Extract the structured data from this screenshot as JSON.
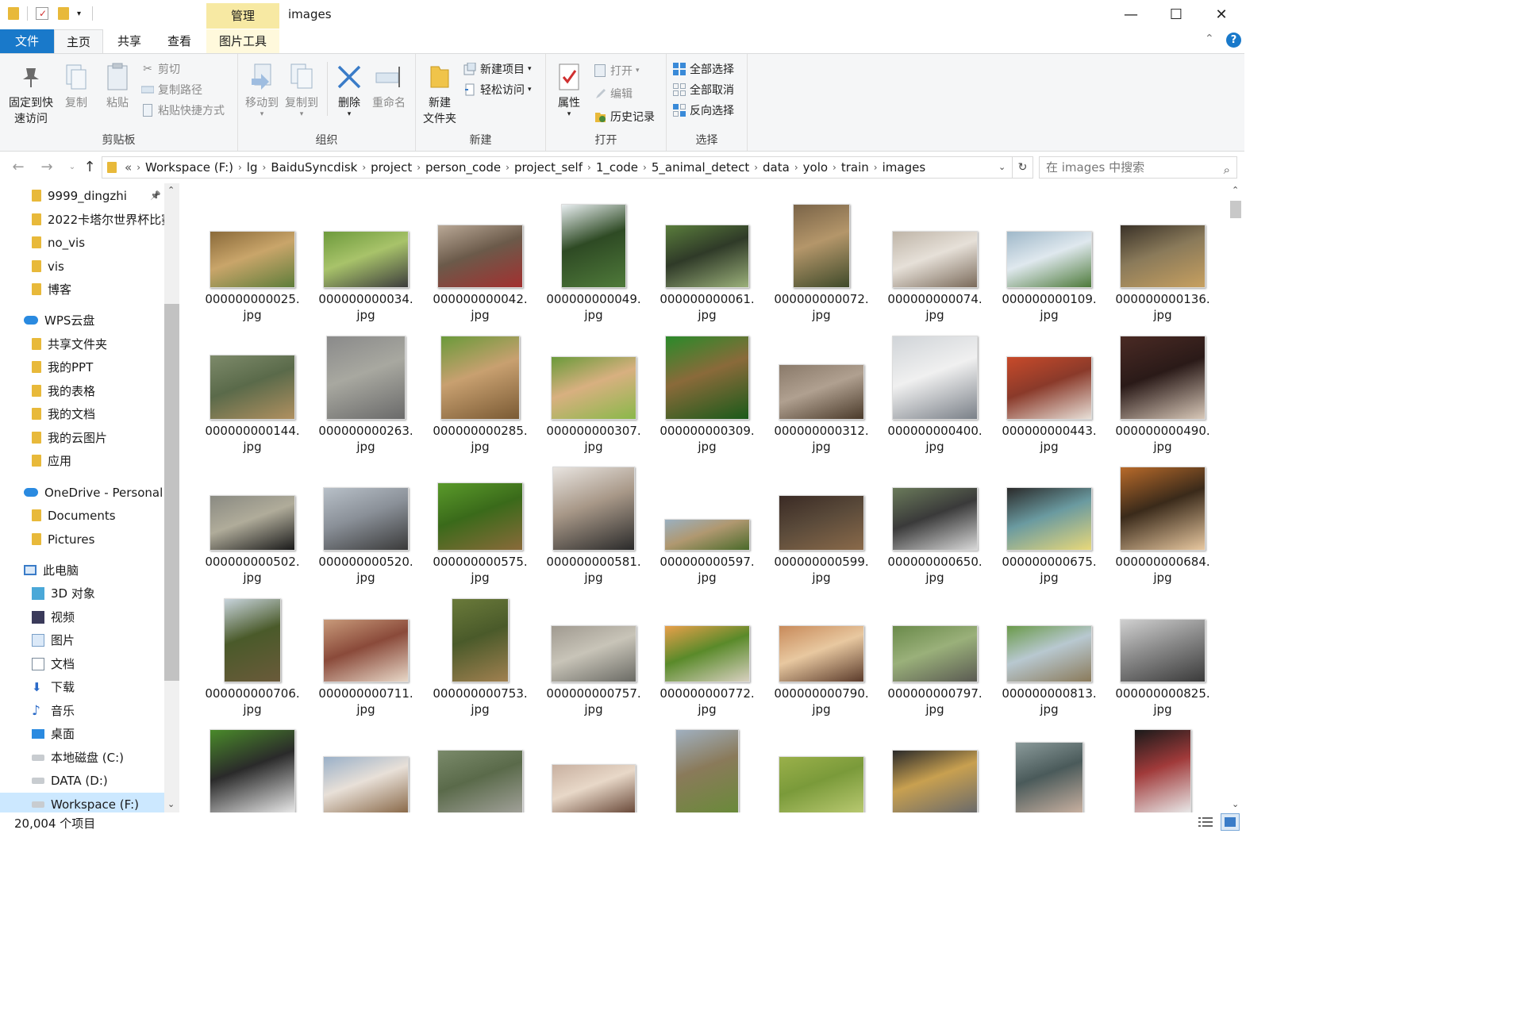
{
  "window": {
    "title": "images",
    "context_tab_header": "管理",
    "minimize": "—",
    "maximize": "☐",
    "close": "✕"
  },
  "tabs": [
    {
      "label": "文件"
    },
    {
      "label": "主页"
    },
    {
      "label": "共享"
    },
    {
      "label": "查看"
    },
    {
      "label": "图片工具"
    }
  ],
  "ribbon": {
    "clipboard": {
      "label": "剪贴板",
      "pin": "固定到快\n速访问",
      "copy": "复制",
      "paste": "粘贴",
      "cut": "剪切",
      "copy_path": "复制路径",
      "paste_shortcut": "粘贴快捷方式"
    },
    "organize": {
      "label": "组织",
      "move_to": "移动到",
      "copy_to": "复制到",
      "delete": "删除",
      "rename": "重命名"
    },
    "new": {
      "label": "新建",
      "new_folder": "新建\n文件夹",
      "new_item": "新建项目",
      "easy_access": "轻松访问"
    },
    "open": {
      "label": "打开",
      "properties": "属性",
      "open": "打开",
      "edit": "编辑",
      "history": "历史记录"
    },
    "select": {
      "label": "选择",
      "select_all": "全部选择",
      "select_none": "全部取消",
      "invert": "反向选择"
    }
  },
  "address": {
    "overflow": "«",
    "crumbs": [
      "Workspace (F:)",
      "lg",
      "BaiduSyncdisk",
      "project",
      "person_code",
      "project_self",
      "1_code",
      "5_animal_detect",
      "data",
      "yolo",
      "train",
      "images"
    ],
    "search_placeholder": "在 images 中搜索"
  },
  "nav_pane": {
    "items": [
      {
        "label": "9999_dingzhi",
        "icon": "folder-icon",
        "pinned": true
      },
      {
        "label": "2022卡塔尔世界杯比赛",
        "icon": "folder-icon"
      },
      {
        "label": "no_vis",
        "icon": "folder-icon"
      },
      {
        "label": "vis",
        "icon": "folder-icon"
      },
      {
        "label": "博客",
        "icon": "folder-icon"
      },
      {
        "label": "WPS云盘",
        "icon": "cloud-icon"
      },
      {
        "label": "共享文件夹",
        "icon": "shared-folder-icon"
      },
      {
        "label": "我的PPT",
        "icon": "folder-icon"
      },
      {
        "label": "我的表格",
        "icon": "folder-icon"
      },
      {
        "label": "我的文档",
        "icon": "folder-icon"
      },
      {
        "label": "我的云图片",
        "icon": "folder-icon"
      },
      {
        "label": "应用",
        "icon": "app-folder-icon"
      },
      {
        "label": "OneDrive - Personal",
        "icon": "onedrive-icon"
      },
      {
        "label": "Documents",
        "icon": "folder-icon"
      },
      {
        "label": "Pictures",
        "icon": "folder-icon"
      },
      {
        "label": "此电脑",
        "icon": "pc-icon"
      },
      {
        "label": "3D 对象",
        "icon": "3d-objects-icon"
      },
      {
        "label": "视频",
        "icon": "video-icon"
      },
      {
        "label": "图片",
        "icon": "pictures-icon"
      },
      {
        "label": "文档",
        "icon": "documents-icon"
      },
      {
        "label": "下载",
        "icon": "download-icon"
      },
      {
        "label": "音乐",
        "icon": "music-icon"
      },
      {
        "label": "桌面",
        "icon": "desktop-icon"
      },
      {
        "label": "本地磁盘 (C:)",
        "icon": "drive-icon"
      },
      {
        "label": "DATA (D:)",
        "icon": "drive-icon"
      },
      {
        "label": "Workspace (F:)",
        "icon": "drive-icon",
        "selected": true
      }
    ]
  },
  "files": [
    {
      "name": "000000000025.",
      "ext": "jpg",
      "colors": [
        "#8a6a3a",
        "#5e7d3a",
        "#c9a56a"
      ]
    },
    {
      "name": "000000000034.",
      "ext": "jpg",
      "colors": [
        "#6d9a3c",
        "#3d3d3d",
        "#a8c36a"
      ]
    },
    {
      "name": "000000000042.",
      "ext": "jpg",
      "colors": [
        "#b9a896",
        "#a33030",
        "#6b5a4a"
      ]
    },
    {
      "name": "000000000049.",
      "ext": "jpg",
      "colors": [
        "#e8eef0",
        "#4f7a3a",
        "#2e4a24"
      ]
    },
    {
      "name": "000000000061.",
      "ext": "jpg",
      "colors": [
        "#5a7d3c",
        "#9bb07a",
        "#2f3a28"
      ]
    },
    {
      "name": "000000000072.",
      "ext": "jpg",
      "colors": [
        "#7a6448",
        "#3f4a2a",
        "#b4966a"
      ]
    },
    {
      "name": "000000000074.",
      "ext": "jpg",
      "colors": [
        "#bfb5a8",
        "#7a6a5a",
        "#e6e0d8"
      ]
    },
    {
      "name": "000000000109.",
      "ext": "jpg",
      "colors": [
        "#9fb8c9",
        "#4d7a3a",
        "#dfe8ee"
      ]
    },
    {
      "name": "000000000136.",
      "ext": "jpg",
      "colors": [
        "#3a3228",
        "#c7a060",
        "#8a7a5a"
      ]
    },
    {
      "name": "000000000144.",
      "ext": "jpg",
      "colors": [
        "#7d8a6a",
        "#b09060",
        "#5a6a4a"
      ]
    },
    {
      "name": "000000000263.",
      "ext": "jpg",
      "colors": [
        "#8a8a8a",
        "#6a6a6a",
        "#a8a8a0"
      ]
    },
    {
      "name": "000000000285.",
      "ext": "jpg",
      "colors": [
        "#6a9a3a",
        "#7a5a34",
        "#c8a070"
      ]
    },
    {
      "name": "000000000307.",
      "ext": "jpg",
      "colors": [
        "#6a9a3a",
        "#8ab84a",
        "#d8b080"
      ]
    },
    {
      "name": "000000000309.",
      "ext": "jpg",
      "colors": [
        "#2a8a2a",
        "#1a5a1a",
        "#8a6a3a"
      ]
    },
    {
      "name": "000000000312.",
      "ext": "jpg",
      "colors": [
        "#8a7a6a",
        "#4a3a2a",
        "#b0a090"
      ]
    },
    {
      "name": "000000000400.",
      "ext": "jpg",
      "colors": [
        "#d0d4d8",
        "#7a8088",
        "#f0f0f0"
      ]
    },
    {
      "name": "000000000443.",
      "ext": "jpg",
      "colors": [
        "#c84a2a",
        "#e8e0d8",
        "#8a3a2a"
      ]
    },
    {
      "name": "000000000490.",
      "ext": "jpg",
      "colors": [
        "#4a2a24",
        "#d8c8b8",
        "#2a1a18"
      ]
    },
    {
      "name": "000000000502.",
      "ext": "jpg",
      "colors": [
        "#8a8a82",
        "#1a1a1a",
        "#b0ac9a"
      ]
    },
    {
      "name": "000000000520.",
      "ext": "jpg",
      "colors": [
        "#b8c0c8",
        "#3a3a3a",
        "#8a9098"
      ]
    },
    {
      "name": "000000000575.",
      "ext": "jpg",
      "colors": [
        "#5a9a2a",
        "#8a6a3a",
        "#3a6a1a"
      ]
    },
    {
      "name": "000000000581.",
      "ext": "jpg",
      "colors": [
        "#e8e4e0",
        "#2a2a2a",
        "#a89888"
      ]
    },
    {
      "name": "000000000597.",
      "ext": "jpg",
      "colors": [
        "#9ab0c0",
        "#4a6a2a",
        "#b09870"
      ]
    },
    {
      "name": "000000000599.",
      "ext": "jpg",
      "colors": [
        "#3a2a24",
        "#8a6a4a",
        "#5a4a3a"
      ]
    },
    {
      "name": "000000000650.",
      "ext": "jpg",
      "colors": [
        "#6a7a5a",
        "#d8d8d8",
        "#3a3a3a"
      ]
    },
    {
      "name": "000000000675.",
      "ext": "jpg",
      "colors": [
        "#2a2a2a",
        "#e8d87a",
        "#6a9aa0"
      ]
    },
    {
      "name": "000000000684.",
      "ext": "jpg",
      "colors": [
        "#b86a2a",
        "#e8c8a0",
        "#3a2a1a"
      ]
    },
    {
      "name": "000000000706.",
      "ext": "jpg",
      "colors": [
        "#c8d4dc",
        "#6a5a3a",
        "#4a5a2a"
      ]
    },
    {
      "name": "000000000711.",
      "ext": "jpg",
      "colors": [
        "#c89a7a",
        "#e8d8c8",
        "#8a4a3a"
      ]
    },
    {
      "name": "000000000753.",
      "ext": "jpg",
      "colors": [
        "#6a7a3a",
        "#a08050",
        "#4a5a2a"
      ]
    },
    {
      "name": "000000000757.",
      "ext": "jpg",
      "colors": [
        "#a09a90",
        "#6a6a64",
        "#c8c4b8"
      ]
    },
    {
      "name": "000000000772.",
      "ext": "jpg",
      "colors": [
        "#e8a04a",
        "#d8d0c0",
        "#5a8a2a"
      ]
    },
    {
      "name": "000000000790.",
      "ext": "jpg",
      "colors": [
        "#c88a5a",
        "#5a3a2a",
        "#e8c8a0"
      ]
    },
    {
      "name": "000000000797.",
      "ext": "jpg",
      "colors": [
        "#6a8a4a",
        "#5a5a52",
        "#9ab07a"
      ]
    },
    {
      "name": "000000000813.",
      "ext": "jpg",
      "colors": [
        "#6a9a4a",
        "#8a7a5a",
        "#b8c8d0"
      ]
    },
    {
      "name": "000000000825.",
      "ext": "jpg",
      "colors": [
        "#d0d0d0",
        "#3a3a3a",
        "#8a8a8a"
      ]
    },
    {
      "name": "",
      "ext": "",
      "colors": [
        "#4a8a2a",
        "#e8e8e8",
        "#2a2a2a"
      ]
    },
    {
      "name": "",
      "ext": "",
      "colors": [
        "#9ab0c8",
        "#8a6a4a",
        "#e8e0d8"
      ]
    },
    {
      "name": "",
      "ext": "",
      "colors": [
        "#7a8a6a",
        "#a0a098",
        "#5a6a4a"
      ]
    },
    {
      "name": "",
      "ext": "",
      "colors": [
        "#c8b0a0",
        "#6a4a3a",
        "#e8d8c8"
      ]
    },
    {
      "name": "",
      "ext": "",
      "colors": [
        "#a0b0c0",
        "#6a8a3a",
        "#8a7a5a"
      ]
    },
    {
      "name": "",
      "ext": "",
      "colors": [
        "#9ab04a",
        "#b8c870",
        "#7a9a3a"
      ]
    },
    {
      "name": "",
      "ext": "",
      "colors": [
        "#2a2a2a",
        "#6a6a6a",
        "#c8a050"
      ]
    },
    {
      "name": "",
      "ext": "",
      "colors": [
        "#8a9a9a",
        "#c8b0a0",
        "#4a5a5a"
      ]
    },
    {
      "name": "",
      "ext": "",
      "colors": [
        "#1a1a1a",
        "#e8e8e8",
        "#a03a3a"
      ]
    }
  ],
  "status": {
    "count": "20,004 个项目"
  },
  "colors": {
    "accent": "#1979ca",
    "ribbon_bg": "#f5f6f7",
    "context_tab": "#f7e9a3",
    "selection": "#cce8ff",
    "folder": "#e8b93a"
  }
}
